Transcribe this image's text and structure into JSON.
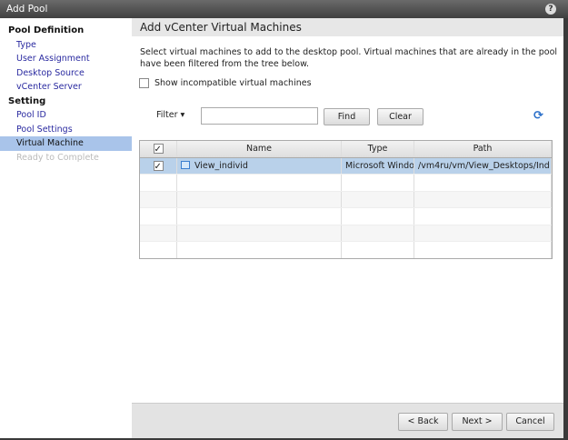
{
  "window": {
    "title": "Add Pool",
    "help_icon": "help-icon"
  },
  "sidebar": {
    "sections": [
      {
        "title": "Pool Definition",
        "items": [
          {
            "label": "Type",
            "state": "link"
          },
          {
            "label": "User Assignment",
            "state": "link"
          },
          {
            "label": "Desktop Source",
            "state": "link"
          },
          {
            "label": "vCenter Server",
            "state": "link"
          }
        ]
      },
      {
        "title": "Setting",
        "items": [
          {
            "label": "Pool ID",
            "state": "link"
          },
          {
            "label": "Pool Settings",
            "state": "link"
          },
          {
            "label": "Virtual Machine",
            "state": "active"
          },
          {
            "label": "Ready to Complete",
            "state": "disabled"
          }
        ]
      }
    ]
  },
  "main": {
    "title": "Add vCenter Virtual Machines",
    "description": "Select virtual machines to add to the desktop pool. Virtual machines that are already in the pool have been filtered from the tree below.",
    "show_incompatible": {
      "label": "Show incompatible virtual machines",
      "checked": false
    },
    "filter": {
      "label": "Filter ▾",
      "value": "",
      "find": "Find",
      "clear": "Clear"
    },
    "table": {
      "columns": [
        "Name",
        "Type",
        "Path"
      ],
      "header_checked": true,
      "rows": [
        {
          "checked": true,
          "name": "View_individ",
          "type": "Microsoft Windo",
          "path": "/vm4ru/vm/View_Desktops/Ind",
          "selected": true
        }
      ]
    }
  },
  "footer": {
    "back": "< Back",
    "next": "Next >",
    "cancel": "Cancel"
  },
  "colors": {
    "selection": "#b9d1ea",
    "active_nav": "#a9c4ea",
    "link": "#2a2aa0"
  }
}
